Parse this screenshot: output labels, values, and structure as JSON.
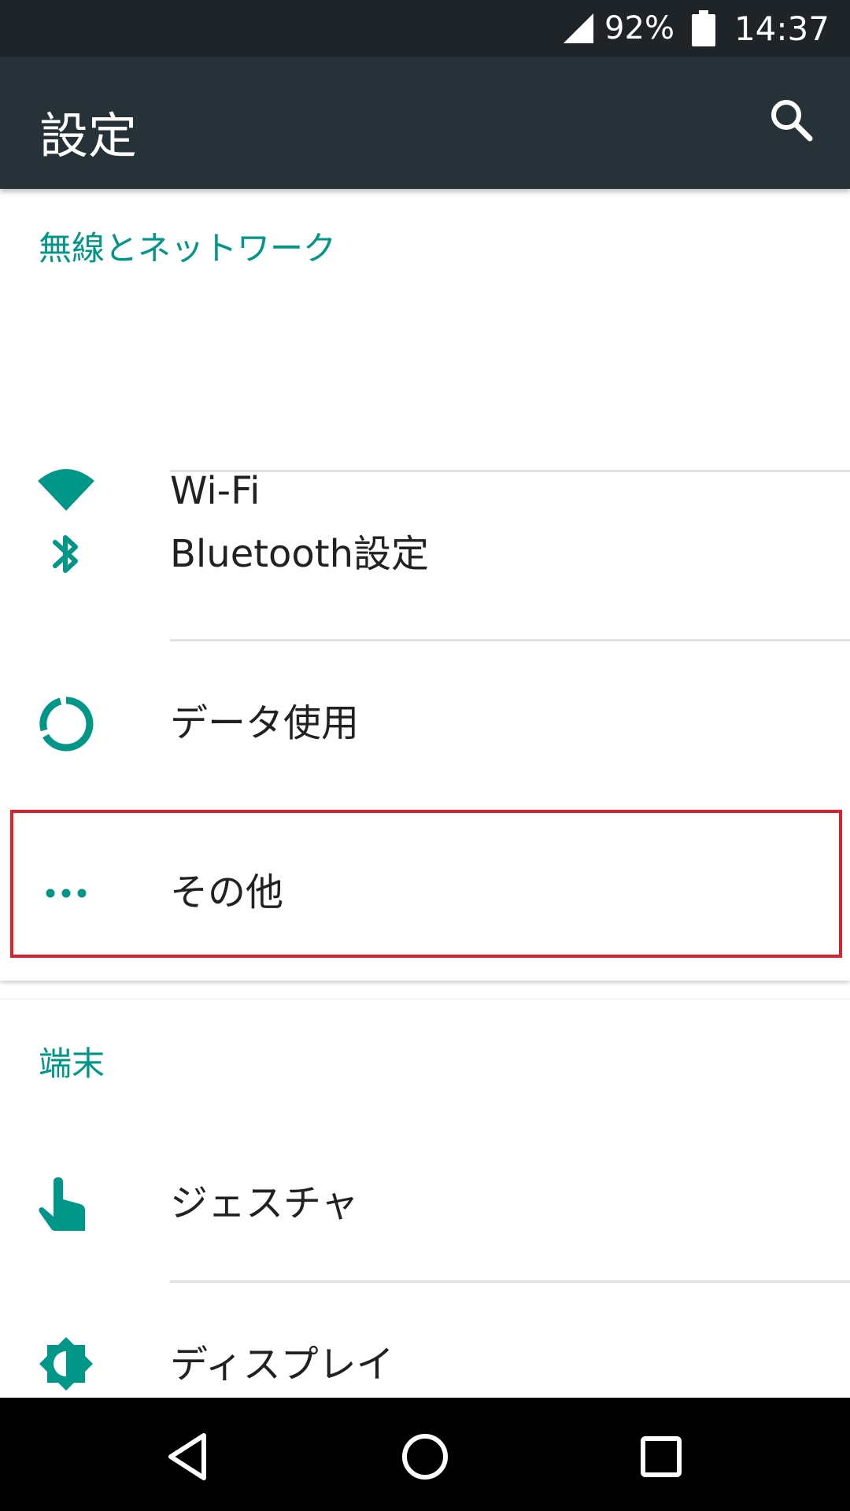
{
  "status_bar": {
    "signal_icon": "cell-signal-icon",
    "battery_percent": "92%",
    "battery_icon": "battery-icon",
    "time": "14:37"
  },
  "app_bar": {
    "title": "設定",
    "search_icon": "search-icon"
  },
  "sections": [
    {
      "header": "無線とネットワーク",
      "items": [
        {
          "label": "Wi-Fi",
          "icon": "wifi-icon"
        },
        {
          "label": "Bluetooth設定",
          "icon": "bluetooth-icon"
        },
        {
          "label": "データ使用",
          "icon": "data-usage-icon"
        },
        {
          "label": "その他",
          "icon": "more-icon"
        }
      ]
    },
    {
      "header": "端末",
      "items": [
        {
          "label": "ジェスチャ",
          "icon": "gesture-icon"
        },
        {
          "label": "ディスプレイ",
          "icon": "brightness-icon"
        }
      ]
    }
  ],
  "nav_bar": {
    "back_icon": "back-icon",
    "home_icon": "home-icon",
    "recents_icon": "recents-icon"
  },
  "colors": {
    "accent": "#009688",
    "app_bar": "#263238",
    "status_bar": "#1f2428",
    "highlight": "#e01f2d",
    "nav_bar": "#000000"
  }
}
